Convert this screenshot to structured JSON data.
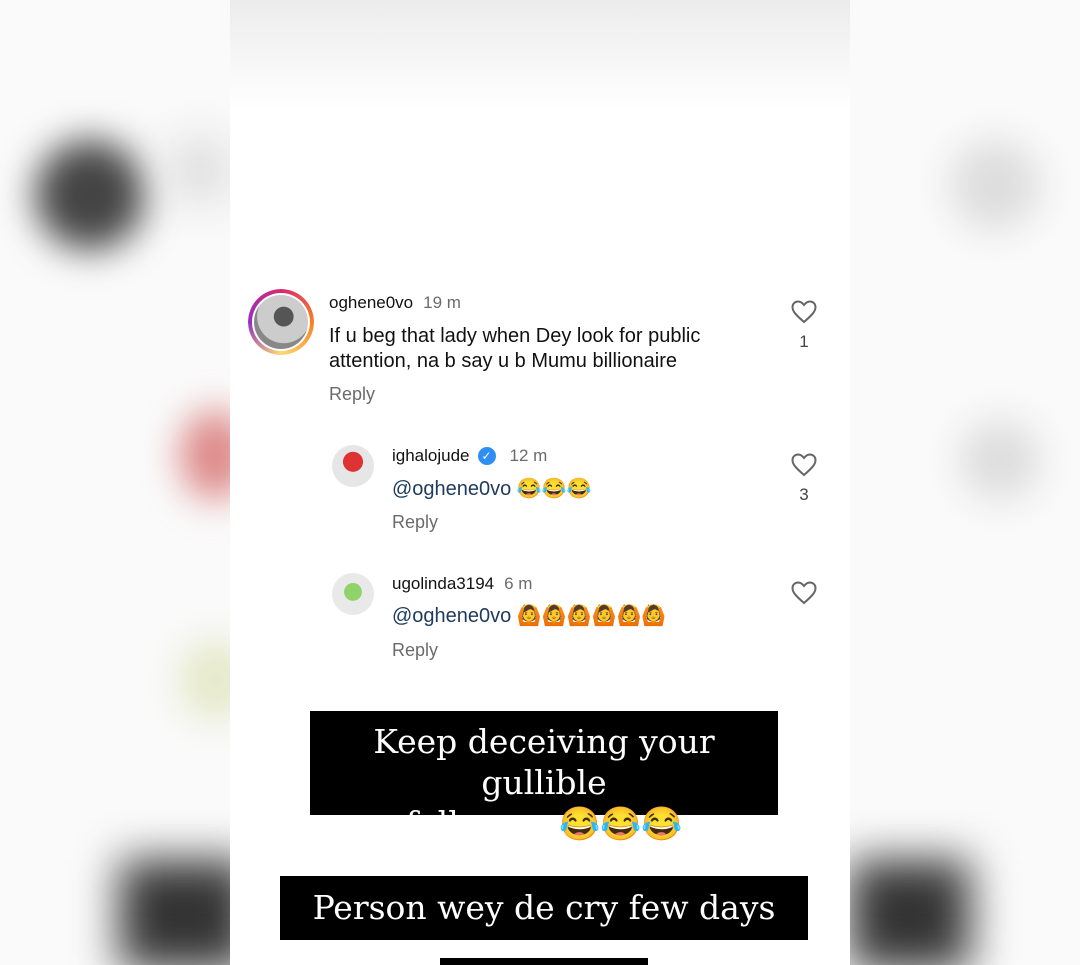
{
  "comments": [
    {
      "username": "oghene0vo",
      "time": "19 m",
      "text": "If u beg that lady when Dey look for public attention, na b say u b Mumu billionaire",
      "reply_label": "Reply",
      "likes": "1"
    },
    {
      "username": "ighalojude",
      "verified": true,
      "time": "12 m",
      "mention": "@oghene0vo",
      "emojis": "😂😂😂",
      "reply_label": "Reply",
      "likes": "3"
    },
    {
      "username": "ugolinda3194",
      "time": "6 m",
      "mention": "@oghene0vo",
      "emojis": "🙆🙆🙆🙆🙆🙆",
      "reply_label": "Reply",
      "likes": ""
    }
  ],
  "captions": [
    {
      "line1": "Keep deceiving your gullible",
      "line2": "followers😂😂😂"
    },
    {
      "line1": "Person wey de cry few days ago"
    }
  ],
  "icons": {
    "like": "heart-outline-icon",
    "verified": "verified-check-icon"
  },
  "colors": {
    "caption_bg": "#000000",
    "verified": "#2f8ef4",
    "ring": "#d62976"
  }
}
